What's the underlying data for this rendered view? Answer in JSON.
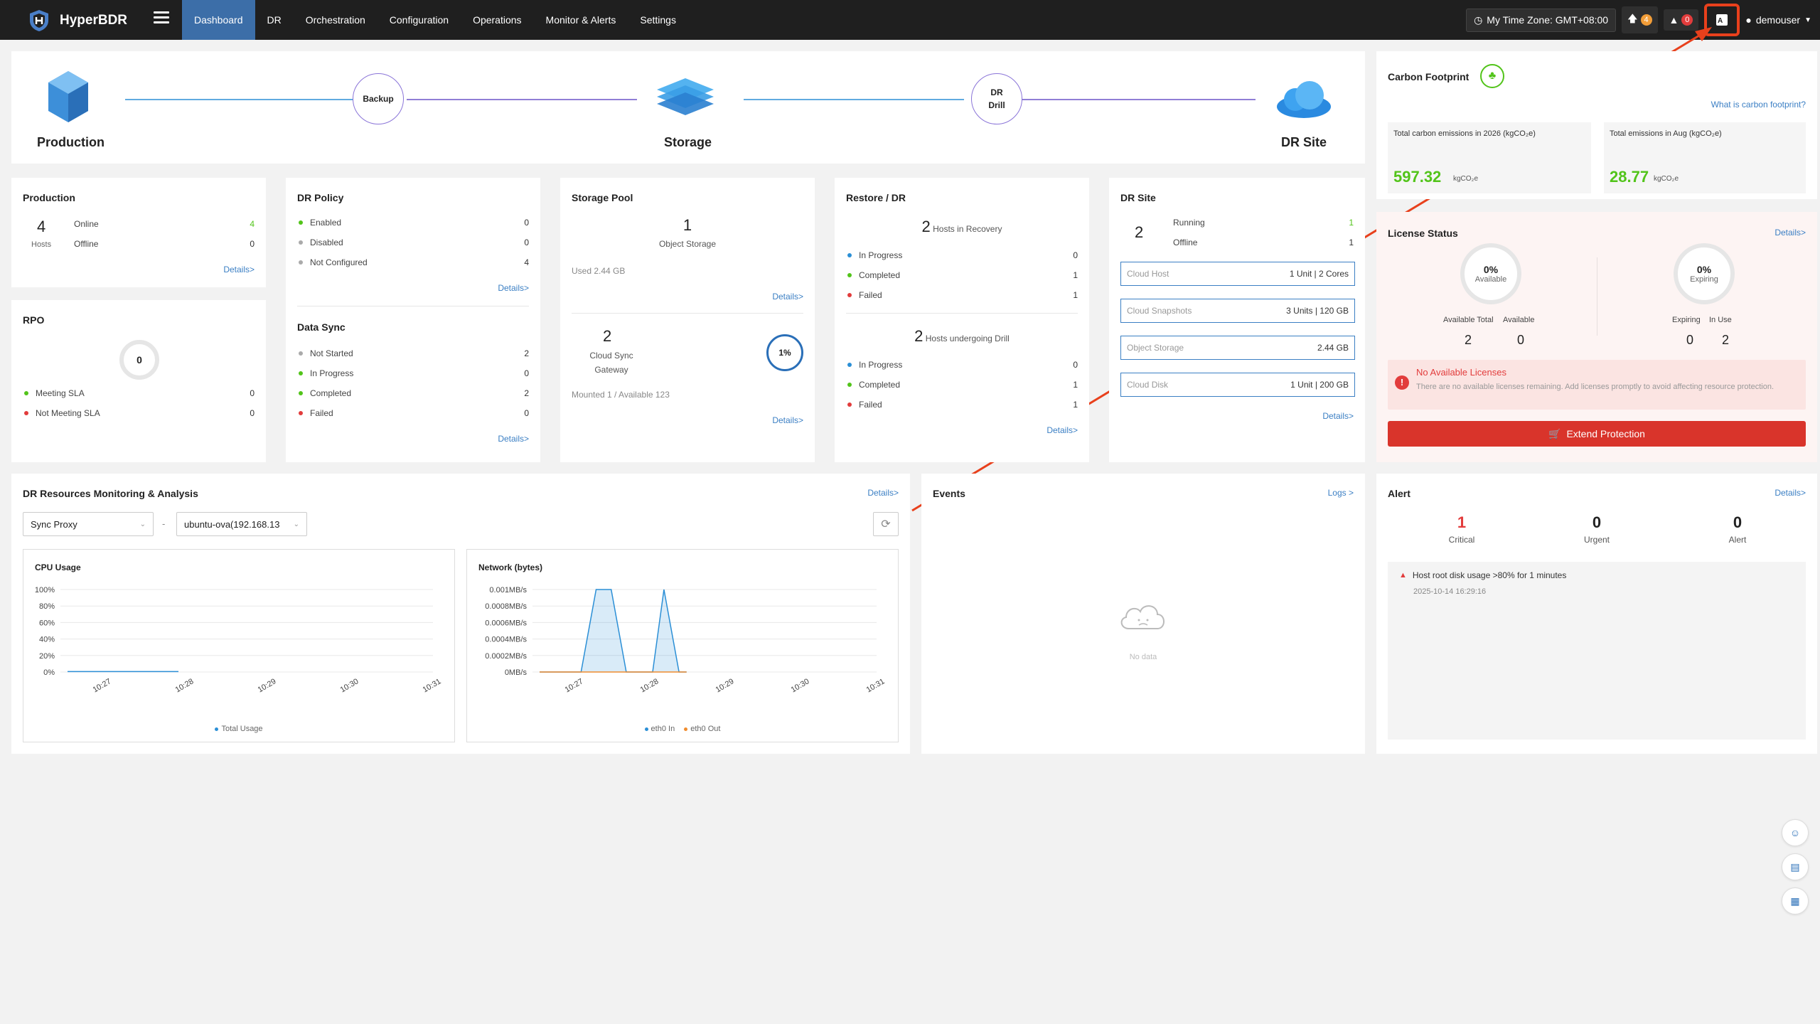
{
  "nav": {
    "brand": "HyperBDR",
    "tabs": [
      "Dashboard",
      "DR",
      "Orchestration",
      "Configuration",
      "Operations",
      "Monitor & Alerts",
      "Settings"
    ],
    "timezone": "My Time Zone: GMT+08:00",
    "upgrade_count": "4",
    "alert_count": "0",
    "user": "demouser"
  },
  "flow": {
    "production": "Production",
    "backup": "Backup",
    "storage": "Storage",
    "dr_drill_1": "DR",
    "dr_drill_2": "Drill",
    "dr_site": "DR Site"
  },
  "production": {
    "title": "Production",
    "hosts_count": "4",
    "hosts_label": "Hosts",
    "online_label": "Online",
    "online_value": "4",
    "offline_label": "Offline",
    "offline_value": "0",
    "details": "Details>"
  },
  "rpo": {
    "title": "RPO",
    "ring_value": "0",
    "meeting_label": "Meeting SLA",
    "meeting_value": "0",
    "not_meeting_label": "Not Meeting SLA",
    "not_meeting_value": "0"
  },
  "dr_policy": {
    "title": "DR Policy",
    "enabled_label": "Enabled",
    "enabled_value": "0",
    "disabled_label": "Disabled",
    "disabled_value": "0",
    "not_configured_label": "Not Configured",
    "not_configured_value": "4",
    "details": "Details>"
  },
  "data_sync": {
    "title": "Data Sync",
    "not_started_label": "Not Started",
    "not_started_value": "2",
    "in_progress_label": "In Progress",
    "in_progress_value": "0",
    "completed_label": "Completed",
    "completed_value": "2",
    "failed_label": "Failed",
    "failed_value": "0",
    "details": "Details>"
  },
  "storage_pool": {
    "title": "Storage Pool",
    "object_storage_count": "1",
    "object_storage_label": "Object Storage",
    "used": "Used 2.44 GB",
    "details1": "Details>",
    "gateway_count": "2",
    "gateway_label_1": "Cloud Sync",
    "gateway_label_2": "Gateway",
    "gateway_ring": "1%",
    "mounted": "Mounted 1 / Available 123",
    "details2": "Details>"
  },
  "restore_dr": {
    "title": "Restore / DR",
    "recovery_count": "2",
    "recovery_label": "Hosts in Recovery",
    "r_in_progress_label": "In Progress",
    "r_in_progress_value": "0",
    "r_completed_label": "Completed",
    "r_completed_value": "1",
    "r_failed_label": "Failed",
    "r_failed_value": "1",
    "drill_count": "2",
    "drill_label": "Hosts undergoing Drill",
    "d_in_progress_label": "In Progress",
    "d_in_progress_value": "0",
    "d_completed_label": "Completed",
    "d_completed_value": "1",
    "d_failed_label": "Failed",
    "d_failed_value": "1",
    "details": "Details>"
  },
  "dr_site": {
    "title": "DR Site",
    "count": "2",
    "running_label": "Running",
    "running_value": "1",
    "offline_label": "Offline",
    "offline_value": "1",
    "cloud_host_label": "Cloud Host",
    "cloud_host_value": "1 Unit  |  2 Cores",
    "cloud_snapshots_label": "Cloud Snapshots",
    "cloud_snapshots_value": "3 Units  |  120 GB",
    "object_storage_label": "Object Storage",
    "object_storage_value": "2.44 GB",
    "cloud_disk_label": "Cloud Disk",
    "cloud_disk_value": "1 Unit  |  200 GB",
    "details": "Details>"
  },
  "carbon": {
    "title": "Carbon Footprint",
    "what_link": "What is carbon footprint?",
    "total_label": "Total carbon emissions in 2026 (kgCO₂e)",
    "total_value": "597.32",
    "total_unit": "kgCO₂e",
    "month_label": "Total emissions in Aug (kgCO₂e)",
    "month_value": "28.77",
    "month_unit": "kgCO₂e"
  },
  "license": {
    "title": "License Status",
    "details": "Details>",
    "available_pct": "0%",
    "available_label": "Available",
    "expiring_pct": "0%",
    "expiring_label": "Expiring",
    "available_total_label": "Available Total",
    "available_total_value": "2",
    "available_label2": "Available",
    "available_value": "0",
    "expiring_label2": "Expiring",
    "expiring_value": "0",
    "in_use_label": "In Use",
    "in_use_value": "2",
    "warning_title": "No Available Licenses",
    "warning_text": "There are no available licenses remaining. Add licenses promptly to avoid affecting resource protection.",
    "extend_button": "Extend Protection"
  },
  "monitoring": {
    "title": "DR Resources Monitoring & Analysis",
    "details": "Details>",
    "select1": "Sync Proxy",
    "separator": "-",
    "select2": "ubuntu-ova(192.168.13"
  },
  "cpu_chart": {
    "title": "CPU Usage",
    "legend": "Total Usage"
  },
  "net_chart": {
    "title": "Network (bytes)",
    "legend_in": "eth0 In",
    "legend_out": "eth0 Out"
  },
  "events": {
    "title": "Events",
    "logs": "Logs >",
    "empty": "No data"
  },
  "alert": {
    "title": "Alert",
    "details": "Details>",
    "critical_value": "1",
    "critical_label": "Critical",
    "urgent_value": "0",
    "urgent_label": "Urgent",
    "alert_value": "0",
    "alert_label": "Alert",
    "item_text": "Host root disk usage >80% for 1 minutes",
    "item_time": "2025-10-14 16:29:16"
  },
  "chart_data": [
    {
      "type": "line",
      "title": "CPU Usage",
      "x": [
        "10:27",
        "10:28",
        "10:29",
        "10:30",
        "10:31"
      ],
      "yticks": [
        "100%",
        "80%",
        "60%",
        "40%",
        "20%",
        "0%"
      ],
      "ylim": [
        0,
        100
      ],
      "series": [
        {
          "name": "Total Usage",
          "color": "#2b8fd6",
          "values": [
            0.5,
            0.5,
            null,
            null,
            null
          ]
        }
      ]
    },
    {
      "type": "area",
      "title": "Network (bytes)",
      "x": [
        "10:27",
        "10:28",
        "10:29",
        "10:30",
        "10:31"
      ],
      "yticks": [
        "0.001MB/s",
        "0.0008MB/s",
        "0.0006MB/s",
        "0.0004MB/s",
        "0.0002MB/s",
        "0MB/s"
      ],
      "ylim": [
        0,
        0.001
      ],
      "series": [
        {
          "name": "eth0 In",
          "color": "#2b8fd6",
          "points": [
            [
              0,
              0
            ],
            [
              0.55,
              0
            ],
            [
              0.75,
              0.001
            ],
            [
              0.95,
              0.001
            ],
            [
              1.15,
              0
            ],
            [
              1.5,
              0
            ],
            [
              1.65,
              0.001
            ],
            [
              1.85,
              0
            ],
            [
              1.95,
              0
            ]
          ]
        },
        {
          "name": "eth0 Out",
          "color": "#f08c2e",
          "points": [
            [
              0,
              0
            ],
            [
              1.95,
              0
            ]
          ]
        }
      ]
    }
  ]
}
